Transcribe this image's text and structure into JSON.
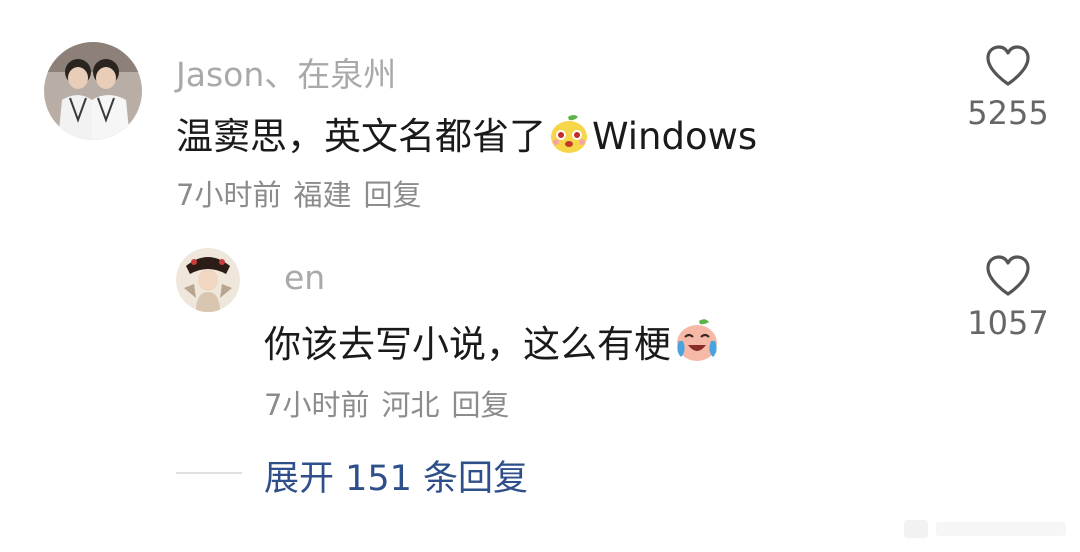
{
  "comments": [
    {
      "username": "Jason、在泉州",
      "text_before": "温窦思，英文名都省了",
      "emoji": "pear-face-emoji",
      "text_after": "Windows",
      "time": "7小时前",
      "location": "福建",
      "reply_label": "回复",
      "likes": "5255"
    },
    {
      "username": "en",
      "text_before": "你该去写小说，这么有梗",
      "emoji": "crying-laughing-peach-emoji",
      "text_after": "",
      "time": "7小时前",
      "location": "河北",
      "reply_label": "回复",
      "likes": "1057"
    }
  ],
  "expand_replies": "展开 151 条回复",
  "icons": {
    "like": "heart-outline-icon"
  },
  "colors": {
    "link": "#2f4f8a",
    "meta": "#8c8c8c",
    "username": "#a9a9a9"
  }
}
